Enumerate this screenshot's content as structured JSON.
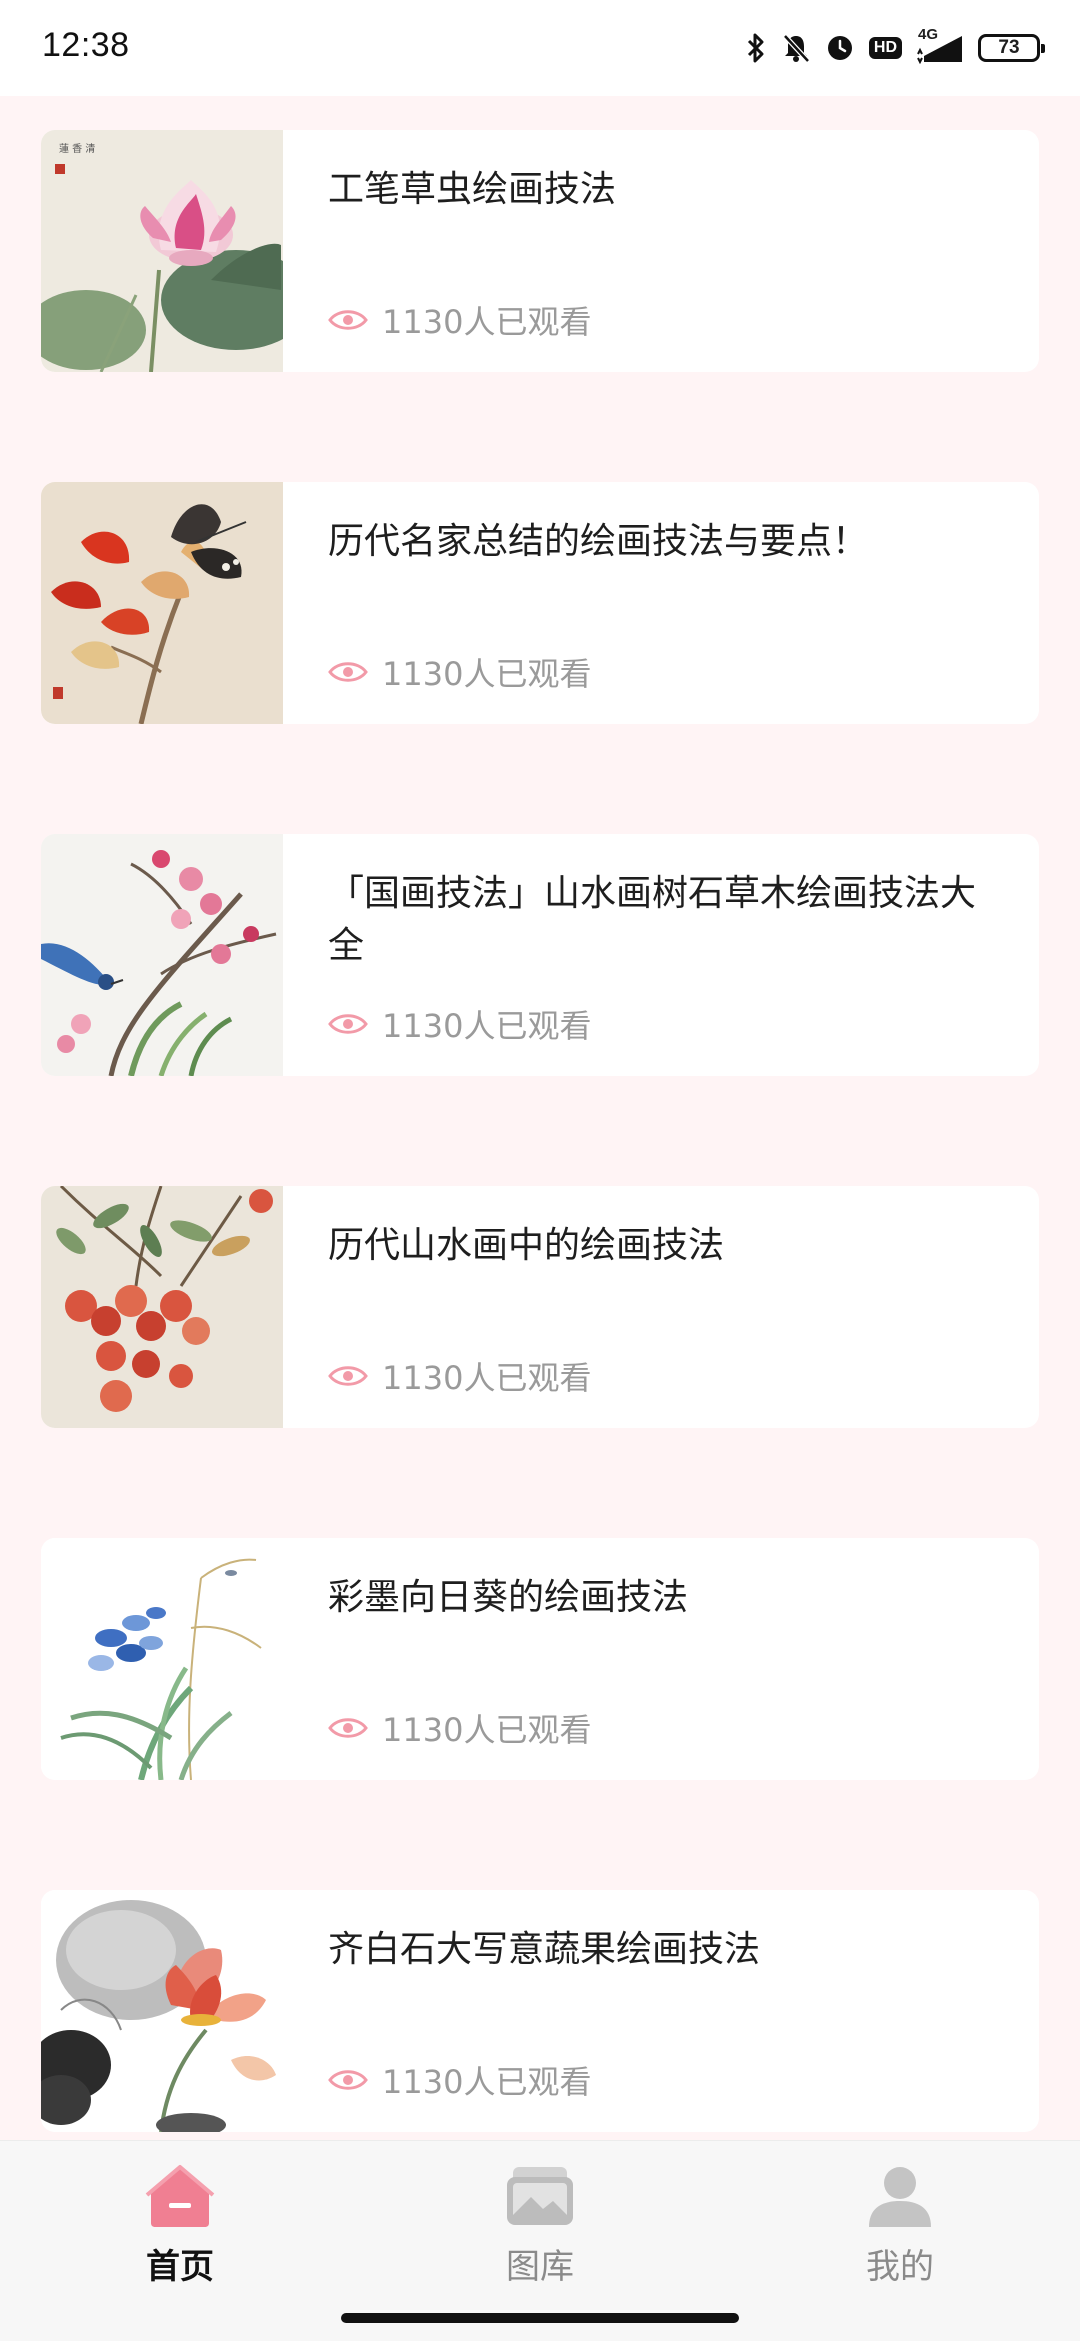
{
  "status_bar": {
    "time": "12:38",
    "battery": "73",
    "network": "4G",
    "hd": "HD"
  },
  "articles": [
    {
      "title": "工笔草虫绘画技法",
      "views": "1130人已观看",
      "thumb": "lotus-painting"
    },
    {
      "title": "历代名家总结的绘画技法与要点！",
      "views": "1130人已观看",
      "thumb": "butterfly-red-leaves-painting"
    },
    {
      "title": "「国画技法」山水画树石草木绘画技法大全",
      "views": "1130人已观看",
      "thumb": "plum-blossom-bird-painting"
    },
    {
      "title": "历代山水画中的绘画技法",
      "views": "1130人已观看",
      "thumb": "lychee-painting"
    },
    {
      "title": "彩墨向日葵的绘画技法",
      "views": "1130人已观看",
      "thumb": "blue-iris-painting"
    },
    {
      "title": "齐白石大写意蔬果绘画技法",
      "views": "1130人已观看",
      "thumb": "ink-lotus-painting"
    }
  ],
  "bottom_nav": [
    {
      "label": "首页",
      "icon": "home-icon",
      "active": true
    },
    {
      "label": "图库",
      "icon": "gallery-icon",
      "active": false
    },
    {
      "label": "我的",
      "icon": "profile-icon",
      "active": false
    }
  ],
  "colors": {
    "background": "#fff4f5",
    "accent": "#f07f92",
    "eye_icon": "#f29aa8",
    "muted_text": "#9a9a9a"
  }
}
